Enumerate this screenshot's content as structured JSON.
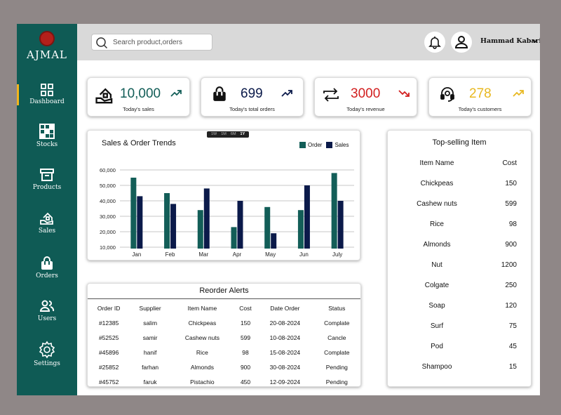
{
  "colors": {
    "sidebar": "#0f5b55",
    "accent": "#f2b51c",
    "order_series": "#135e58",
    "sales_series": "#0b1a4a",
    "revenue_red": "#d21f1f",
    "customers_gold": "#e8b820"
  },
  "brand": {
    "name": "AJMAL"
  },
  "sidebar": {
    "items": [
      {
        "label": "Dashboard",
        "icon": "grid-icon",
        "active": true
      },
      {
        "label": "Stocks",
        "icon": "stocks-grid-icon"
      },
      {
        "label": "Products",
        "icon": "archive-box-icon"
      },
      {
        "label": "Sales",
        "icon": "hand-house-icon"
      },
      {
        "label": "Orders",
        "icon": "shopping-bag-icon"
      },
      {
        "label": "Users",
        "icon": "users-icon"
      },
      {
        "label": "Settings",
        "icon": "gear-icon"
      }
    ]
  },
  "header": {
    "search_placeholder": "Search product,orders",
    "user_name": "Hammad Kabariya"
  },
  "stats": [
    {
      "value": "10,000",
      "label": "Today's sales",
      "icon": "hand-house-icon",
      "trend": "up",
      "color": "#135e58"
    },
    {
      "value": "699",
      "label": "Today's total orders",
      "icon": "shopping-bag-icon",
      "trend": "up",
      "color": "#0b1a4a"
    },
    {
      "value": "3000",
      "label": "Today's revenue",
      "icon": "repeat-icon",
      "trend": "down",
      "color": "#d21f1f"
    },
    {
      "value": "278",
      "label": "Today's customers",
      "icon": "headset-icon",
      "trend": "up",
      "color": "#e8b820"
    }
  ],
  "chart": {
    "range_tabs": [
      "1W",
      "1M",
      "6M",
      "1Y"
    ],
    "active_range": "1Y"
  },
  "chart_data": {
    "type": "bar",
    "title": "Sales & Order Trends",
    "categories": [
      "Jan",
      "Feb",
      "Mar",
      "Apr",
      "May",
      "Jun",
      "July"
    ],
    "series": [
      {
        "name": "Order",
        "color": "#135e58",
        "values": [
          55000,
          45000,
          34000,
          23000,
          36000,
          34000,
          58000
        ]
      },
      {
        "name": "Sales",
        "color": "#0b1a4a",
        "values": [
          43000,
          38000,
          48000,
          40000,
          19000,
          50000,
          40000
        ]
      }
    ],
    "y_ticks": [
      "60,000",
      "50,000",
      "40,000",
      "30,000",
      "20,000",
      "10,000"
    ],
    "y_tick_values": [
      60000,
      50000,
      40000,
      30000,
      20000,
      10000
    ],
    "ylim": [
      10000,
      60000
    ],
    "grid": true,
    "legend": "top-right"
  },
  "reorder": {
    "title": "Reorder Alerts",
    "columns": [
      "Order ID",
      "Supplier",
      "Item Name",
      "Cost",
      "Date Order",
      "Status"
    ],
    "rows": [
      [
        "#12385",
        "salim",
        "Chickpeas",
        "150",
        "20-08-2024",
        "Complate"
      ],
      [
        "#52525",
        "samir",
        "Cashew nuts",
        "599",
        "10-08-2024",
        "Cancle"
      ],
      [
        "#45896",
        "hanif",
        "Rice",
        "98",
        "15-08-2024",
        "Complate"
      ],
      [
        "#25852",
        "farhan",
        "Almonds",
        "900",
        "30-08-2024",
        "Pending"
      ],
      [
        "#45752",
        "faruk",
        "Pistachio",
        "450",
        "12-09-2024",
        "Pending"
      ]
    ]
  },
  "top_selling": {
    "title": "Top-selling Item",
    "columns": [
      "Item Name",
      "Cost"
    ],
    "rows": [
      [
        "Chickpeas",
        "150"
      ],
      [
        "Cashew nuts",
        "599"
      ],
      [
        "Rice",
        "98"
      ],
      [
        "Almonds",
        "900"
      ],
      [
        "Nut",
        "1200"
      ],
      [
        "Colgate",
        "250"
      ],
      [
        "Soap",
        "120"
      ],
      [
        "Surf",
        "75"
      ],
      [
        "Pod",
        "45"
      ],
      [
        "Shampoo",
        "15"
      ]
    ]
  }
}
